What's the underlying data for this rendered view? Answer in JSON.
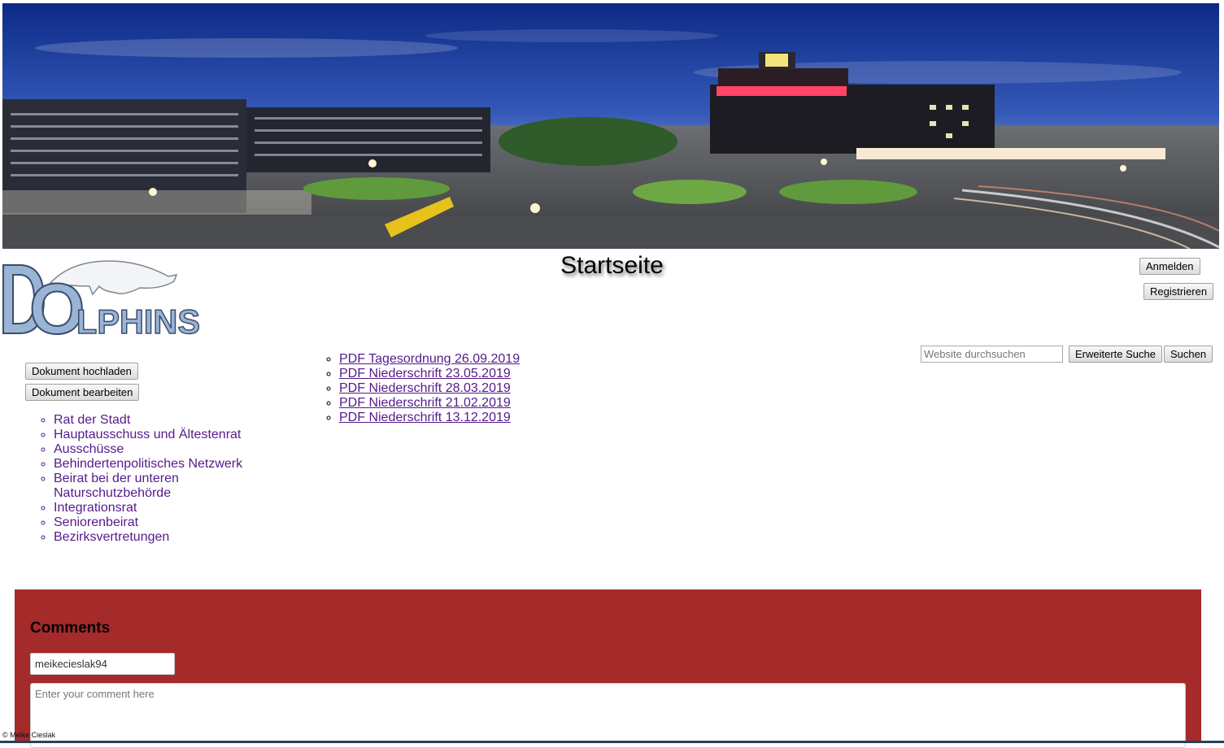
{
  "header": {
    "page_title": "Startseite",
    "login_label": "Anmelden",
    "register_label": "Registrieren"
  },
  "logo": {
    "text_d": "D",
    "text_o": "O",
    "text_rest": "LPHINS",
    "icon": "dolphin-icon"
  },
  "search": {
    "placeholder": "Website durchsuchen",
    "advanced_label": "Erweiterte Suche",
    "submit_label": "Suchen"
  },
  "actions": {
    "upload_label": "Dokument hochladen",
    "edit_label": "Dokument bearbeiten"
  },
  "nav": {
    "items": [
      "Rat der Stadt",
      "Hauptausschuss und Ältestenrat",
      "Ausschüsse",
      "Behindertenpolitisches Netzwerk",
      "Beirat bei der unteren Naturschutzbehörde",
      "Integrationsrat",
      "Seniorenbeirat",
      "Bezirksvertretungen"
    ]
  },
  "documents": {
    "items": [
      "PDF Tagesordnung 26.09.2019",
      "PDF Niederschrift 23.05.2019",
      "PDF Niederschrift 28.03.2019",
      "PDF Niederschrift 21.02.2019",
      "PDF Niederschrift 13.12.2019"
    ]
  },
  "comments": {
    "title": "Comments",
    "name_value": "meikecieslak94",
    "comment_placeholder": "Enter your comment here",
    "background_color": "#a52a2a"
  },
  "footer": {
    "copyright": "© Meike Cieslak"
  },
  "colors": {
    "link_visited": "#551a8b",
    "logo_fill": "#9ab4d6",
    "logo_stroke": "#3a4d6a"
  }
}
